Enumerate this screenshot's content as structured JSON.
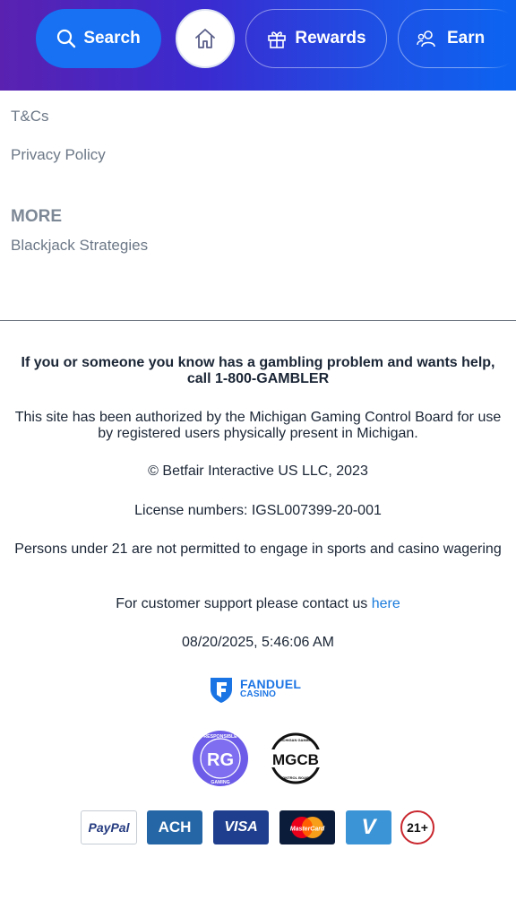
{
  "nav": {
    "search_label": "Search",
    "rewards_label": "Rewards",
    "earn_label": "Earn"
  },
  "links": {
    "tcs": "T&Cs",
    "privacy": "Privacy Policy",
    "more_heading": "MORE",
    "blackjack": "Blackjack Strategies"
  },
  "footer": {
    "gambling_help": "If you or someone you know has a gambling problem and wants help, call 1-800-GAMBLER",
    "authorization": "This site has been authorized by the Michigan Gaming Control Board for use by registered users physically present in Michigan.",
    "copyright": "© Betfair Interactive US LLC, 2023",
    "license": "License numbers: IGSL007399-20-001",
    "age_notice": "Persons under 21 are not permitted to engage in sports and casino wagering",
    "support_prefix": "For customer support please contact us",
    "support_link": "here",
    "timestamp": "08/20/2025, 5:46:06 AM"
  },
  "logos": {
    "fanduel_line1": "FANDUEL",
    "fanduel_line2": "CASINO",
    "rg_center": "RG",
    "rg_top": "RESPONSIBLE",
    "rg_bottom": "GAMING",
    "mgcb_center": "MGCB",
    "mgcb_top": "MICHIGAN GAMING",
    "mgcb_bottom": "CONTROL BOARD"
  },
  "payments": {
    "paypal": "PayPal",
    "ach": "ACH",
    "visa": "VISA",
    "mastercard": "MasterCard",
    "venmo": "V",
    "age": "21+"
  },
  "colors": {
    "accent_blue": "#1771f2",
    "link_blue": "#1a7bdc",
    "rg_purple": "#6c5ce7"
  }
}
